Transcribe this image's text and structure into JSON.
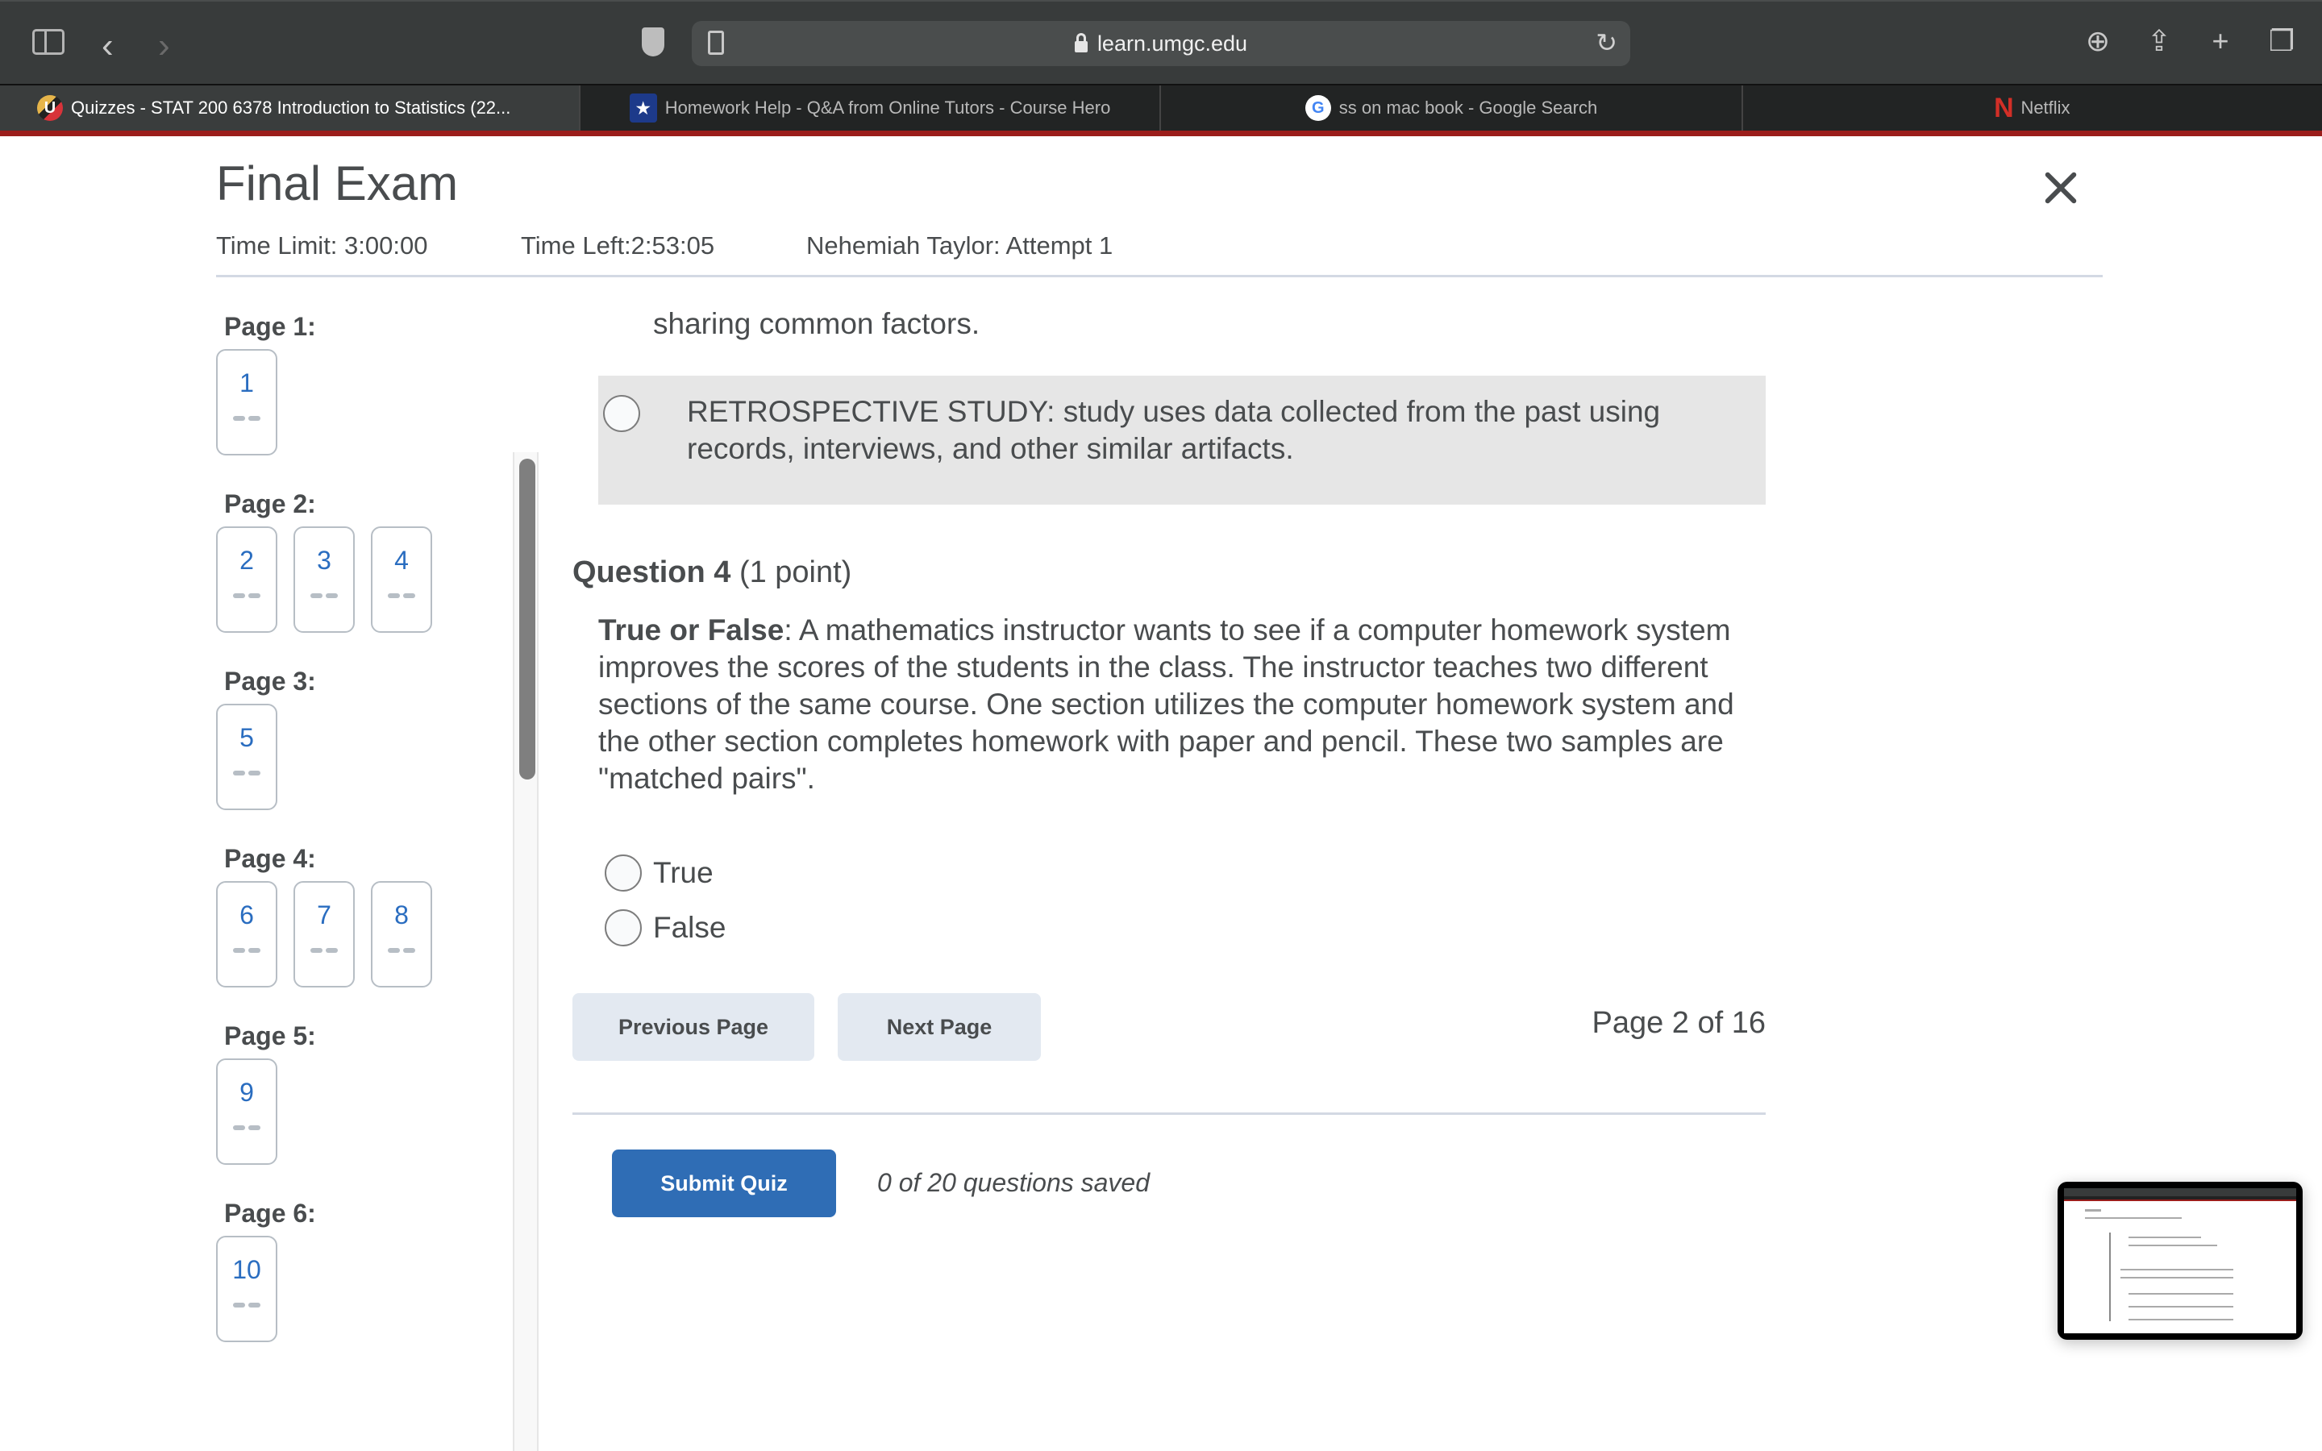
{
  "browser": {
    "url": "learn.umgc.edu",
    "icons": {
      "sidebar": "sidebar-toggle-icon",
      "back": "chevron-left-icon",
      "forward": "chevron-right-icon",
      "privacy": "shield-icon",
      "reader": "reader-icon",
      "lock": "lock-icon",
      "reload": "reload-icon",
      "download": "download-icon",
      "share": "share-icon",
      "new_tab": "plus-icon",
      "tabs_overview": "tabs-icon"
    },
    "glyphs": {
      "back": "‹",
      "forward": "›",
      "reload": "↻",
      "download": "⊕",
      "share": "⇪",
      "new_tab": "+",
      "tabs_overview": "❐"
    },
    "tabs": [
      {
        "title": "Quizzes - STAT 200 6378 Introduction to Statistics (22...",
        "favicon": "U",
        "active": true
      },
      {
        "title": "Homework Help - Q&A from Online Tutors - Course Hero",
        "favicon": "★",
        "active": false
      },
      {
        "title": "ss on mac book - Google Search",
        "favicon": "G",
        "active": false
      },
      {
        "title": "Netflix",
        "favicon": "N",
        "active": false
      }
    ],
    "accent_color": "#9b1d1b"
  },
  "quiz": {
    "title": "Final Exam",
    "time_limit": "Time Limit: 3:00:00",
    "time_left": "Time Left:2:53:05",
    "attempt": "Nehemiah Taylor: Attempt 1",
    "close_label": "×"
  },
  "question_nav": {
    "pages": [
      {
        "label": "Page 1:",
        "questions": [
          "1"
        ]
      },
      {
        "label": "Page 2:",
        "questions": [
          "2",
          "3",
          "4"
        ]
      },
      {
        "label": "Page 3:",
        "questions": [
          "5"
        ]
      },
      {
        "label": "Page 4:",
        "questions": [
          "6",
          "7",
          "8"
        ]
      },
      {
        "label": "Page 5:",
        "questions": [
          "9"
        ]
      },
      {
        "label": "Page 6:",
        "questions": [
          "10"
        ]
      }
    ],
    "number_color": "#2a6dc0"
  },
  "main": {
    "previous_option_fragment": "sharing common factors.",
    "retrospective_option": "RETROSPECTIVE STUDY:  study uses data collected from the past using records, interviews, and other similar artifacts.",
    "question4": {
      "label": "Question 4",
      "points": "(1 point)",
      "prefix": "True or False",
      "text": ":  A mathematics instructor wants to see if a computer homework system improves the scores of the students in the class.  The instructor teaches two different sections of the same course.  One section utilizes the computer homework system and the other section completes homework with paper and pencil.  These two samples are \"matched pairs\".",
      "options": [
        "True",
        "False"
      ]
    },
    "previous_page": "Previous Page",
    "next_page": "Next Page",
    "page_indicator": "Page 2 of 16",
    "submit": "Submit Quiz",
    "saved_status": "0 of 20 questions saved",
    "submit_color": "#2f6db5"
  }
}
